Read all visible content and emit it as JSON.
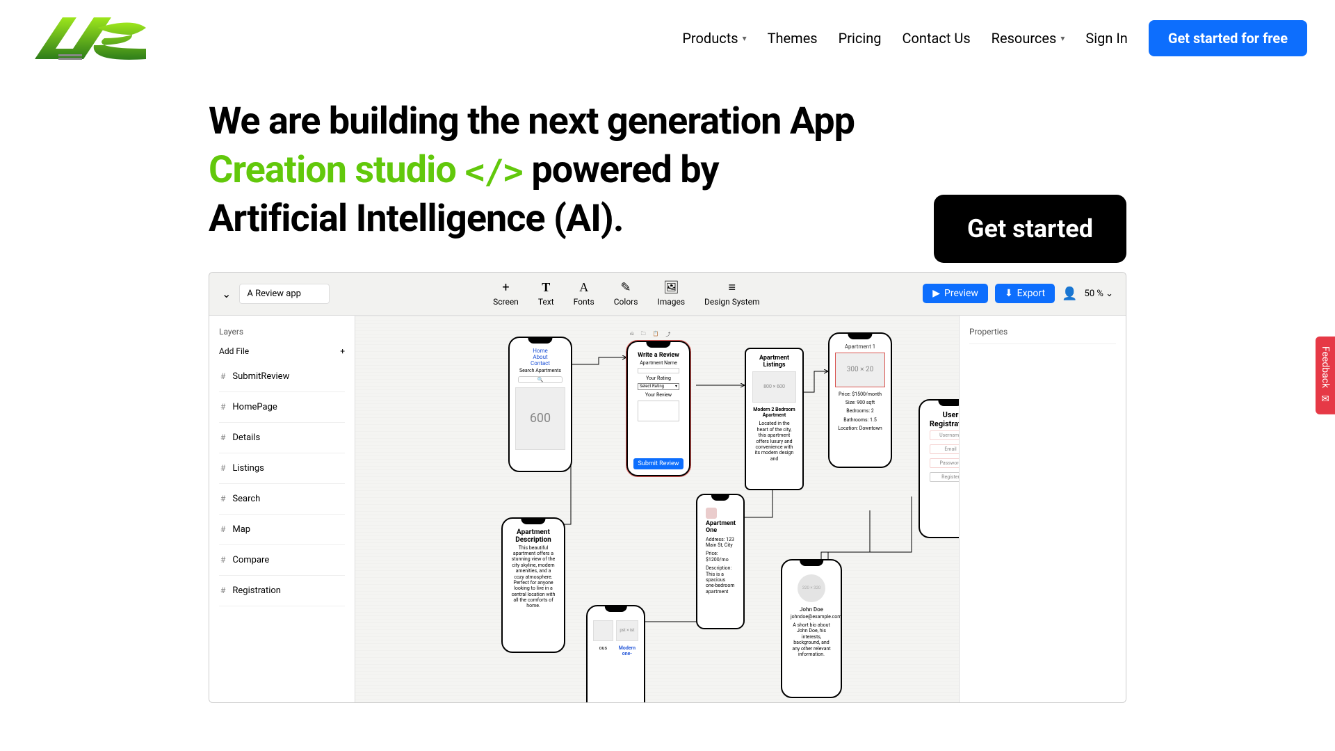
{
  "nav": {
    "items": [
      "Products",
      "Themes",
      "Pricing",
      "Contact Us",
      "Resources"
    ],
    "signin": "Sign In",
    "cta": "Get started for free"
  },
  "hero": {
    "line1": "We are building the next generation App",
    "green": "Creation studio",
    "code": "</>",
    "line2b": "powered by",
    "line3": "Artificial Intelligence (AI)",
    "dot": ".",
    "cta": "Get started"
  },
  "editor": {
    "project": "A Review app",
    "tools": [
      {
        "icon": "+",
        "label": "Screen"
      },
      {
        "icon": "T",
        "label": "Text"
      },
      {
        "icon": "A",
        "label": "Fonts"
      },
      {
        "icon": "✎",
        "label": "Colors"
      },
      {
        "icon": "🖼",
        "label": "Images"
      },
      {
        "icon": "≡",
        "label": "Design System"
      }
    ],
    "preview": "Preview",
    "export": "Export",
    "zoom": "50 %",
    "layers_hdr": "Layers",
    "addfile": "Add File",
    "layers": [
      "SubmitReview",
      "HomePage",
      "Details",
      "Listings",
      "Search",
      "Map",
      "Compare",
      "Registration"
    ],
    "props_hdr": "Properties",
    "mini_tools": [
      "⎌",
      "🗀",
      "📋",
      "⤴"
    ]
  },
  "phones": {
    "p1_links": [
      "Home",
      "About",
      "Contact"
    ],
    "p1_search": "Search Apartments",
    "p1_box": "600",
    "p2_title": "Write a Review",
    "p2_f1": "Apartment Name",
    "p2_f2": "Your Rating",
    "p2_sel": "Select Rating",
    "p2_f3": "Your Review",
    "p2_btn": "Submit Review",
    "p3_title": "Apartment Listings",
    "p3_box": "800 × 600",
    "p3_name": "Modern 2 Bedroom Apartment",
    "p3_desc": "Located in the heart of the city, this apartment offers luxury and convenience with its modern design and",
    "p4_title": "Apartment 1",
    "p4_box": "300 × 20",
    "p4_l1": "Price: $1500/month",
    "p4_l2": "Size: 900 sqft",
    "p4_l3": "Bedrooms: 2",
    "p4_l4": "Bathrooms: 1.5",
    "p4_l5": "Location: Downtown",
    "p5_title": "User Registration",
    "p5_f": [
      "Username",
      "Email",
      "Password"
    ],
    "p5_btn": "Register",
    "p6_title": "Apartment Description",
    "p6_desc": "This beautiful apartment offers a stunning view of the city skyline, modern amenities, and a cozy atmosphere. Perfect for anyone looking to live in a central location with all the comforts of home.",
    "p7_title": "Apartment One",
    "p7_addr_l": "Address:",
    "p7_addr": "123 Main St, City",
    "p7_price_l": "Price:",
    "p7_price": "$1200/mo",
    "p7_desc_l": "Description:",
    "p7_desc": "This is a spacious one-bedroom apartment",
    "p8_a": "ous",
    "p8_b": "pst × ist",
    "p8_c": "Modern one-",
    "p9_name": "John Doe",
    "p9_email": "johndoe@example.com",
    "p9_desc": "A short bio about John Doe, his interests, background, and any other relevant information."
  },
  "feedback": "Feedback"
}
